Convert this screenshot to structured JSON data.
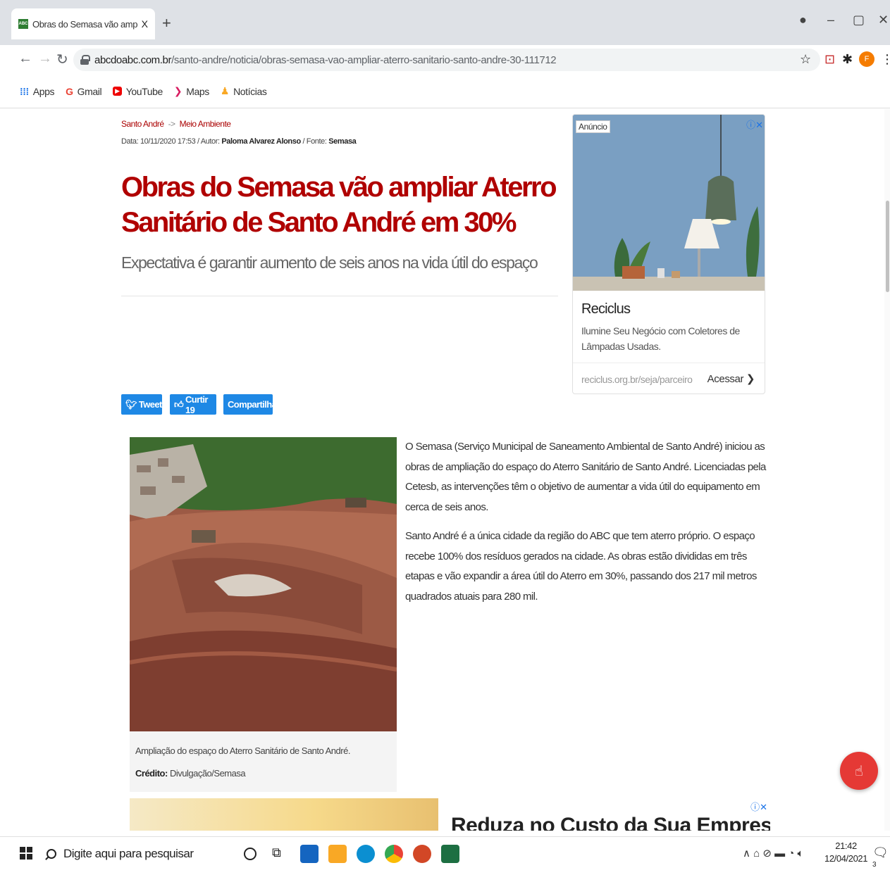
{
  "browser": {
    "tab_title": "Obras do Semasa vão ampliar At",
    "tab_close": "X",
    "new_tab": "+",
    "favicon_text": "ABC",
    "url_domain": "abcdoabc.com.br",
    "url_path": "/santo-andre/noticia/obras-semasa-vao-ampliar-aterro-sanitario-santo-andre-30-111712",
    "avatar_letter": "F",
    "bookmarks": [
      "Apps",
      "Gmail",
      "YouTube",
      "Maps",
      "Notícias"
    ]
  },
  "article": {
    "breadcrumb": [
      "Santo André",
      "Meio Ambiente"
    ],
    "breadcrumb_sep": "->",
    "meta_prefix": "Data: 10/11/2020 17:53 / Autor:",
    "author": "Paloma Alvarez Alonso",
    "source_prefix": "/ Fonte:",
    "source": "Semasa",
    "title": "Obras do Semasa vão ampliar Aterro Sanitário de Santo André em 30%",
    "subtitle": "Expectativa é garantir aumento de seis anos na vida útil do espaço",
    "share": {
      "tweet": "Tweetar",
      "like": "Curtir 19",
      "share": "Compartilhar"
    },
    "caption": "Ampliação do espaço do Aterro Sanitário de Santo André.",
    "credit_label": "Crédito:",
    "credit": "Divulgação/Semasa",
    "paragraphs": [
      "O Semasa (Serviço Municipal de Saneamento Ambiental de Santo André) iniciou as obras de ampliação do espaço do Aterro Sanitário de Santo André. Licenciadas pela Cetesb, as intervenções têm o objetivo de aumentar a vida útil do equipamento em cerca de seis anos.",
      "Santo André é a única cidade da região do ABC que tem aterro próprio. O espaço recebe 100% dos resíduos gerados na cidade. As obras estão divididas em três etapas e vão expandir a área útil do Aterro em 30%, passando dos 217 mil metros quadrados atuais para 280 mil."
    ]
  },
  "ad": {
    "tag": "Anúncio",
    "title": "Reciclus",
    "desc": "Ilumine Seu Negócio com Coletores de Lâmpadas Usadas.",
    "domain": "reciclus.org.br/seja/parceiro",
    "cta": "Acessar ❯"
  },
  "ad2": {
    "title": "Reduza no Custo da Sua Empresa"
  },
  "taskbar": {
    "search_placeholder": "Digite aqui para pesquisar",
    "time": "21:42",
    "date": "12/04/2021",
    "notif_count": "3"
  }
}
